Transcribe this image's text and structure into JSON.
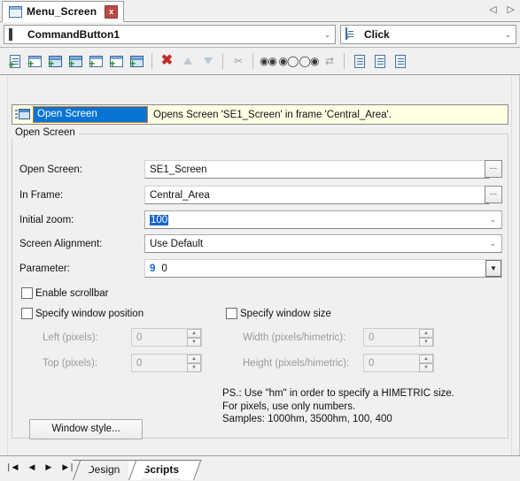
{
  "window": {
    "document_tab": {
      "label": "Menu_Screen",
      "icon": "screen-window-icon",
      "close_label": "x"
    },
    "tab_nav": {
      "prev": "◁",
      "next": "▷"
    }
  },
  "selectors": {
    "object": {
      "value": "CommandButton1",
      "icon": "command-button-icon",
      "arrow": "⌄"
    },
    "event": {
      "value": "Click",
      "icon": "script-event-icon",
      "arrow": "⌄"
    }
  },
  "toolbar": {
    "buttons": [
      {
        "name": "new-script-line",
        "icon": "document-add-icon"
      },
      {
        "name": "new-window-line",
        "icon": "window-add-icon"
      },
      {
        "name": "new-screen-line",
        "icon": "screen-add-icon"
      },
      {
        "name": "new-dialog-line",
        "icon": "dialog-add-icon"
      },
      {
        "name": "new-download-line",
        "icon": "download-add-icon"
      },
      {
        "name": "new-refresh-line",
        "icon": "refresh-add-icon"
      },
      {
        "name": "new-print-line",
        "icon": "print-add-icon"
      }
    ],
    "delete": {
      "name": "delete-line-button",
      "icon": "red-x-icon",
      "glyph": "✖"
    },
    "move_up": {
      "name": "move-up-button",
      "icon": "arrow-up-icon"
    },
    "move_down": {
      "name": "move-down-button",
      "icon": "arrow-down-icon"
    },
    "cut": {
      "name": "cut-button",
      "icon": "cut-icon"
    },
    "find": {
      "name": "find-button",
      "icon": "binoculars-icon",
      "glyph": "ὐD"
    },
    "find_prev": {
      "name": "find-previous-button",
      "icon": "binoculars-prev-icon"
    },
    "find_next": {
      "name": "find-next-button",
      "icon": "binoculars-next-icon"
    },
    "replace": {
      "name": "replace-button",
      "icon": "replace-ab-icon"
    },
    "check1": {
      "name": "validate-script-button",
      "icon": "document-check-icon"
    },
    "check2": {
      "name": "validate-all-button",
      "icon": "document-check-all-icon"
    },
    "check3": {
      "name": "compile-button",
      "icon": "document-compile-icon"
    }
  },
  "action_list": {
    "row": {
      "action_name": "Open Screen",
      "description": "Opens Screen 'SE1_Screen' in frame 'Central_Area'.",
      "icon": "open-screen-icon"
    }
  },
  "group": {
    "title": "Open Screen",
    "fields": {
      "open_screen": {
        "label": "Open Screen:",
        "value": "SE1_Screen",
        "browse_label": "..."
      },
      "in_frame": {
        "label": "In Frame:",
        "value": "Central_Area",
        "browse_label": "..."
      },
      "initial_zoom": {
        "label": "Initial zoom:",
        "value": "100",
        "selected": true
      },
      "screen_alignment": {
        "label": "Screen Alignment:",
        "value": "Use Default"
      },
      "parameter": {
        "label": "Parameter:",
        "index": "9",
        "value": "0",
        "drop_label": "▼"
      }
    },
    "checkboxes": {
      "enable_scrollbar": {
        "label": "Enable scrollbar",
        "checked": false
      },
      "specify_window_position": {
        "label": "Specify window position",
        "checked": false
      },
      "specify_window_size": {
        "label": "Specify window size",
        "checked": false
      }
    },
    "position_fields": {
      "left": {
        "label": "Left (pixels):",
        "value": "0",
        "disabled": true
      },
      "top": {
        "label": "Top (pixels):",
        "value": "0",
        "disabled": true
      }
    },
    "size_fields": {
      "width": {
        "label": "Width (pixels/himetric):",
        "value": "0",
        "disabled": true
      },
      "height": {
        "label": "Height (pixels/himetric):",
        "value": "0",
        "disabled": true
      }
    },
    "note": "PS.: Use \"hm\" in order to specify a HIMETRIC size.\nFor pixels, use only numbers.\nSamples: 1000hm, 3500hm, 100, 400",
    "window_style_button": "Window style..."
  },
  "bottom": {
    "nav": {
      "first": "❘◀",
      "prev": "◀",
      "next": "▶",
      "last": "▶❘"
    },
    "tabs": [
      {
        "label": "Design",
        "active": false
      },
      {
        "label": "Scripts",
        "active": true
      }
    ]
  },
  "colors": {
    "selection_blue": "#0a74d4",
    "focus_orange": "#d07a2a",
    "info_yellow": "#ffffe4",
    "accent_red": "#b84a46",
    "chrome_gray": "#f0f0f0"
  }
}
